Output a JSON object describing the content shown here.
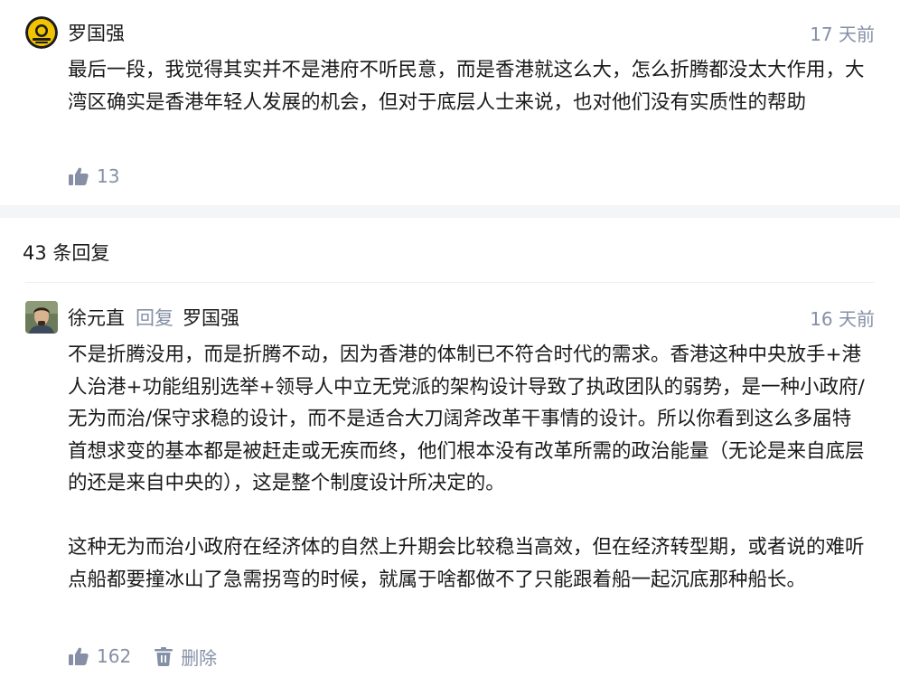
{
  "root_comment": {
    "author": "罗国强",
    "time": "17 天前",
    "content": "最后一段，我觉得其实并不是港府不听民意，而是香港就这么大，怎么折腾都没太大作用，大湾区确实是香港年轻人发展的机会，但对于底层人士来说，也对他们没有实质性的帮助",
    "likes": "13",
    "avatar_icon": "yellow-emblem-avatar"
  },
  "replies_header": {
    "count_label": "43 条回复"
  },
  "reply": {
    "author": "徐元直",
    "reply_word": "回复",
    "reply_to": "罗国强",
    "time": "16 天前",
    "content": "不是折腾没用，而是折腾不动，因为香港的体制已不符合时代的需求。香港这种中央放手+港人治港+功能组别选举+领导人中立无党派的架构设计导致了执政团队的弱势，是一种小政府/无为而治/保守求稳的设计，而不是适合大刀阔斧改革干事情的设计。所以你看到这么多届特首想求变的基本都是被赶走或无疾而终，他们根本没有改革所需的政治能量（无论是来自底层的还是来自中央的），这是整个制度设计所决定的。\n\n这种无为而治小政府在经济体的自然上升期会比较稳当高效，但在经济转型期，或者说的难听点船都要撞冰山了急需拐弯的时候，就属于啥都做不了只能跟着船一起沉底那种船长。",
    "likes": "162",
    "delete_label": "删除",
    "avatar_icon": "portrait-avatar"
  },
  "colors": {
    "meta_gray": "#8590a6",
    "text": "#1a1a1a",
    "gap_bg": "#f4f5f7"
  }
}
